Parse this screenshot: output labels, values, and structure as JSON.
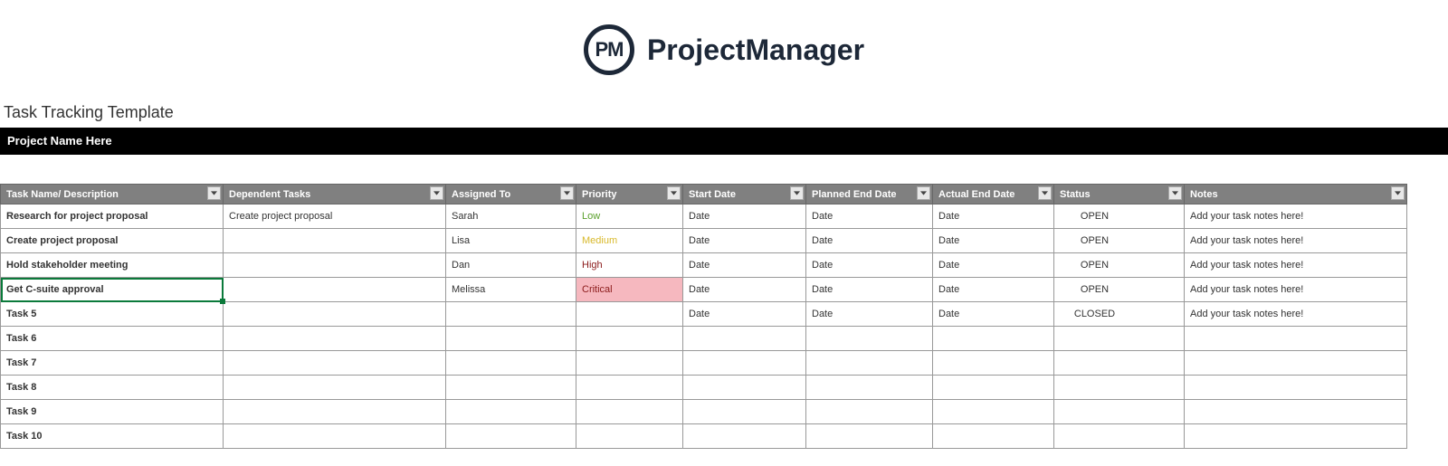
{
  "brand": {
    "badge": "PM",
    "name": "ProjectManager"
  },
  "template_title": "Task Tracking Template",
  "project_name": "Project Name Here",
  "columns": [
    "Task Name/ Description",
    "Dependent Tasks",
    "Assigned To",
    "Priority",
    "Start Date",
    "Planned End Date",
    "Actual End Date",
    "Status",
    "Notes"
  ],
  "rows": [
    {
      "task": "Research for project proposal",
      "dep": "Create project proposal",
      "assigned": "Sarah",
      "priority": "Low",
      "pri_class": "pri-low",
      "start": "Date",
      "plan": "Date",
      "actual": "Date",
      "status": "OPEN",
      "notes": "Add your task notes here!"
    },
    {
      "task": "Create project proposal",
      "dep": "",
      "assigned": "Lisa",
      "priority": "Medium",
      "pri_class": "pri-medium",
      "start": "Date",
      "plan": "Date",
      "actual": "Date",
      "status": "OPEN",
      "notes": "Add your task notes here!"
    },
    {
      "task": "Hold stakeholder meeting",
      "dep": "",
      "assigned": "Dan",
      "priority": "High",
      "pri_class": "pri-high",
      "start": "Date",
      "plan": "Date",
      "actual": "Date",
      "status": "OPEN",
      "notes": "Add your task notes here!"
    },
    {
      "task": "Get C-suite approval",
      "dep": "",
      "assigned": "Melissa",
      "priority": "Critical",
      "pri_class": "pri-critical",
      "start": "Date",
      "plan": "Date",
      "actual": "Date",
      "status": "OPEN",
      "notes": "Add your task notes here!"
    },
    {
      "task": "Task 5",
      "dep": "",
      "assigned": "",
      "priority": "",
      "pri_class": "",
      "start": "Date",
      "plan": "Date",
      "actual": "Date",
      "status": "CLOSED",
      "notes": "Add your task notes here!"
    },
    {
      "task": "Task 6",
      "dep": "",
      "assigned": "",
      "priority": "",
      "pri_class": "",
      "start": "",
      "plan": "",
      "actual": "",
      "status": "",
      "notes": ""
    },
    {
      "task": "Task 7",
      "dep": "",
      "assigned": "",
      "priority": "",
      "pri_class": "",
      "start": "",
      "plan": "",
      "actual": "",
      "status": "",
      "notes": ""
    },
    {
      "task": "Task 8",
      "dep": "",
      "assigned": "",
      "priority": "",
      "pri_class": "",
      "start": "",
      "plan": "",
      "actual": "",
      "status": "",
      "notes": ""
    },
    {
      "task": "Task 9",
      "dep": "",
      "assigned": "",
      "priority": "",
      "pri_class": "",
      "start": "",
      "plan": "",
      "actual": "",
      "status": "",
      "notes": ""
    },
    {
      "task": "Task 10",
      "dep": "",
      "assigned": "",
      "priority": "",
      "pri_class": "",
      "start": "",
      "plan": "",
      "actual": "",
      "status": "",
      "notes": ""
    }
  ],
  "selected_row_index": 3
}
